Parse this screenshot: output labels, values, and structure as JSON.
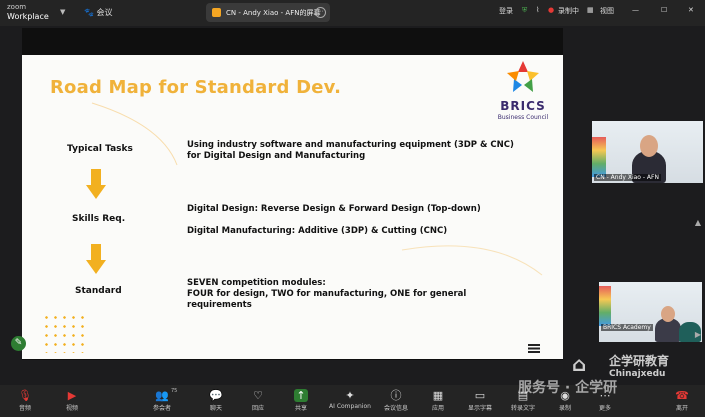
{
  "app": {
    "logo_top": "zoom",
    "logo_bottom": "Workplace",
    "meeting_label": "会议"
  },
  "share_tab": {
    "title": "CN - Andy Xiao - AFN的屏幕"
  },
  "topbar_right": {
    "login": "登录",
    "recording": "录制中",
    "view": "视图"
  },
  "slide": {
    "title": "Road Map for Standard Dev.",
    "logo_word": "BRICS",
    "logo_sub": "Business Council",
    "rows": [
      {
        "label": "Typical Tasks",
        "lines": [
          "Using industry software and manufacturing equipment (3DP & CNC)",
          "for Digital Design and Manufacturing"
        ]
      },
      {
        "label": "Skills Req.",
        "lines": [
          "Digital Design: Reverse Design & Forward Design (Top-down)",
          "Digital Manufacturing: Additive (3DP) & Cutting (CNC)"
        ]
      },
      {
        "label": "Standard",
        "lines": [
          "SEVEN competition modules:",
          "FOUR for design, TWO for manufacturing, ONE for general",
          "requirements"
        ]
      }
    ]
  },
  "videos": [
    {
      "caption": "CN - Andy Xiao - AFN"
    },
    {
      "caption": "BRICS Academy"
    }
  ],
  "toolbar": {
    "items": [
      {
        "label": "音频",
        "icon": "microphone-icon"
      },
      {
        "label": "视频",
        "icon": "video-camera-icon"
      },
      {
        "label": "参会者",
        "icon": "participants-icon",
        "count": "75"
      },
      {
        "label": "聊天",
        "icon": "chat-icon"
      },
      {
        "label": "回应",
        "icon": "reaction-icon"
      },
      {
        "label": "共享",
        "icon": "share-screen-icon"
      },
      {
        "label": "AI Companion",
        "icon": "ai-companion-icon"
      },
      {
        "label": "会议信息",
        "icon": "info-icon"
      },
      {
        "label": "应用",
        "icon": "apps-icon"
      },
      {
        "label": "显示字幕",
        "icon": "captions-icon"
      },
      {
        "label": "转录文字",
        "icon": "transcript-icon"
      },
      {
        "label": "录制",
        "icon": "record-icon"
      },
      {
        "label": "更多",
        "icon": "more-icon"
      },
      {
        "label": "离开",
        "icon": "leave-icon"
      }
    ]
  },
  "watermark": {
    "text1": "企学研教育",
    "text2": "Chinajxedu",
    "text3": "服务号 · 企学研"
  },
  "colors": {
    "accent": "#f2b020",
    "title": "#f0b23a",
    "brand": "#3a2b6e",
    "leave": "#e53935"
  }
}
